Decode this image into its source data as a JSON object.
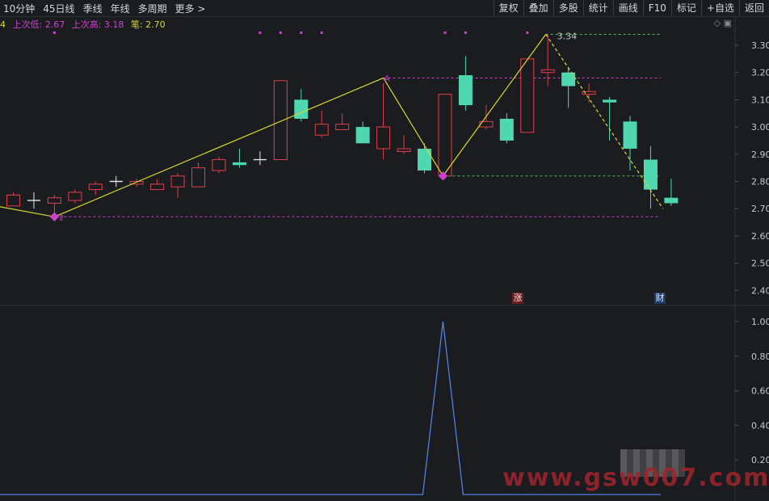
{
  "toolbar": {
    "left": [
      "10分钟",
      "45日线",
      "季线",
      "年线",
      "多周期",
      "更多 >"
    ],
    "right": [
      "复权",
      "叠加",
      "多股",
      "统计",
      "画线",
      "F10",
      "标记",
      "+自选",
      "返回"
    ]
  },
  "legend": {
    "prefix": "4",
    "last_low": "上次低: 2.67",
    "last_high": "上次高: 3.18",
    "stroke": "笔: 2.70"
  },
  "annotations": {
    "peak_label": "3.34",
    "marker_a": "A",
    "marker_b": "B",
    "marker_start": "2"
  },
  "badges": {
    "zhang": "涨",
    "cai": "财"
  },
  "watermark": "www.gsw007.com",
  "colors": {
    "up": "#e0404a",
    "down": "#4fd8b0",
    "zigzag": "#d8d830",
    "level": "#d040d0",
    "green_level": "#44c060",
    "indicator": "#5080e0"
  },
  "chart_data": {
    "type": "candlestick",
    "price_axis": {
      "ticks": [
        "3.30",
        "3.20",
        "3.10",
        "3.00",
        "2.90",
        "2.80",
        "2.70",
        "2.60",
        "2.50",
        "2.40"
      ],
      "ylim": [
        2.4,
        3.3
      ]
    },
    "indicator_axis": {
      "ticks": [
        "1.00",
        "0.80",
        "0.60",
        "0.40",
        "0.20"
      ],
      "ylim": [
        0,
        1.0
      ]
    },
    "candles": [
      {
        "o": 2.71,
        "c": 2.75,
        "h": 2.76,
        "l": 2.71
      },
      {
        "o": 2.73,
        "c": 2.73,
        "h": 2.76,
        "l": 2.7
      },
      {
        "o": 2.72,
        "c": 2.74,
        "h": 2.75,
        "l": 2.67
      },
      {
        "o": 2.73,
        "c": 2.76,
        "h": 2.77,
        "l": 2.72
      },
      {
        "o": 2.77,
        "c": 2.79,
        "h": 2.8,
        "l": 2.75
      },
      {
        "o": 2.8,
        "c": 2.8,
        "h": 2.82,
        "l": 2.78
      },
      {
        "o": 2.79,
        "c": 2.8,
        "h": 2.81,
        "l": 2.78
      },
      {
        "o": 2.77,
        "c": 2.79,
        "h": 2.81,
        "l": 2.77
      },
      {
        "o": 2.78,
        "c": 2.82,
        "h": 2.83,
        "l": 2.74
      },
      {
        "o": 2.78,
        "c": 2.85,
        "h": 2.87,
        "l": 2.78
      },
      {
        "o": 2.84,
        "c": 2.88,
        "h": 2.89,
        "l": 2.83
      },
      {
        "o": 2.87,
        "c": 2.86,
        "h": 2.92,
        "l": 2.85
      },
      {
        "o": 2.88,
        "c": 2.88,
        "h": 2.91,
        "l": 2.86
      },
      {
        "o": 2.88,
        "c": 3.17,
        "h": 3.17,
        "l": 2.88
      },
      {
        "o": 3.1,
        "c": 3.03,
        "h": 3.14,
        "l": 3.02
      },
      {
        "o": 2.97,
        "c": 3.01,
        "h": 3.06,
        "l": 2.96
      },
      {
        "o": 2.99,
        "c": 3.01,
        "h": 3.05,
        "l": 2.99
      },
      {
        "o": 3.0,
        "c": 2.94,
        "h": 3.02,
        "l": 2.94
      },
      {
        "o": 2.92,
        "c": 3.0,
        "h": 3.16,
        "l": 2.88
      },
      {
        "o": 2.91,
        "c": 2.92,
        "h": 2.97,
        "l": 2.9
      },
      {
        "o": 2.92,
        "c": 2.84,
        "h": 2.94,
        "l": 2.83
      },
      {
        "o": 2.82,
        "c": 3.12,
        "h": 3.12,
        "l": 2.82
      },
      {
        "o": 3.19,
        "c": 3.08,
        "h": 3.26,
        "l": 3.06
      },
      {
        "o": 3.0,
        "c": 3.02,
        "h": 3.08,
        "l": 2.99
      },
      {
        "o": 3.03,
        "c": 2.95,
        "h": 3.05,
        "l": 2.94
      },
      {
        "o": 2.98,
        "c": 3.25,
        "h": 3.25,
        "l": 2.98
      },
      {
        "o": 3.2,
        "c": 3.21,
        "h": 3.34,
        "l": 3.15
      },
      {
        "o": 3.2,
        "c": 3.15,
        "h": 3.22,
        "l": 3.07
      },
      {
        "o": 3.12,
        "c": 3.13,
        "h": 3.16,
        "l": 3.09
      },
      {
        "o": 3.1,
        "c": 3.09,
        "h": 3.11,
        "l": 2.95
      },
      {
        "o": 3.02,
        "c": 2.92,
        "h": 3.04,
        "l": 2.84
      },
      {
        "o": 2.88,
        "c": 2.77,
        "h": 2.93,
        "l": 2.7
      },
      {
        "o": 2.74,
        "c": 2.72,
        "h": 2.81,
        "l": 2.71
      }
    ],
    "zigzag": [
      {
        "i": -1.6,
        "p": 2.72
      },
      {
        "i": 2,
        "p": 2.67
      },
      {
        "i": 18,
        "p": 3.18
      },
      {
        "i": 20.9,
        "p": 2.82
      },
      {
        "i": 25.9,
        "p": 3.34
      },
      {
        "i": 31.6,
        "p": 2.7
      }
    ],
    "levels": {
      "low": 2.67,
      "high": 3.18,
      "peak": 3.34,
      "support": 2.82
    },
    "indicator": {
      "baseline_value": 0,
      "peak_value": 1.0,
      "peak_index": 20.9
    }
  }
}
